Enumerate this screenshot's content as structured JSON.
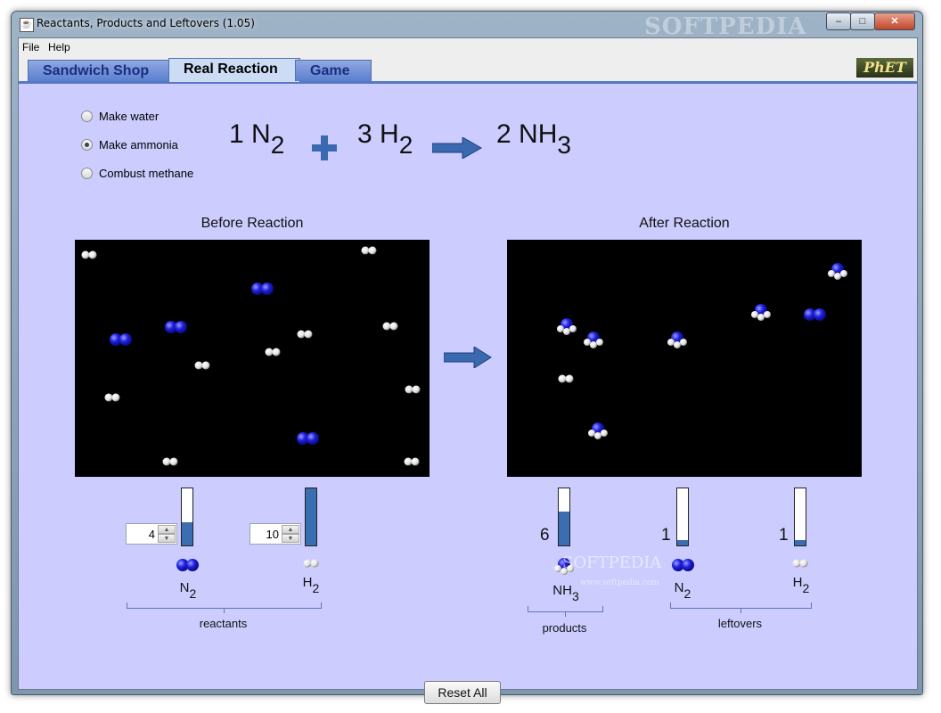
{
  "window": {
    "title": "Reactants, Products and Leftovers (1.05)",
    "watermark": "SOFTPEDIA",
    "controls": {
      "minimize": "–",
      "maximize": "□",
      "close": "✕"
    }
  },
  "menu": [
    "File",
    "Help"
  ],
  "tabs": [
    {
      "label": "Sandwich Shop",
      "active": false
    },
    {
      "label": "Real Reaction",
      "active": true
    },
    {
      "label": "Game",
      "active": false
    }
  ],
  "logo": "PhET",
  "reactions": [
    {
      "label": "Make water",
      "selected": false
    },
    {
      "label": "Make ammonia",
      "selected": true
    },
    {
      "label": "Combust methane",
      "selected": false
    }
  ],
  "equation": {
    "r1_coeff": "1",
    "r1_base": "N",
    "r1_sub": "2",
    "r2_coeff": "3",
    "r2_base": "H",
    "r2_sub": "2",
    "p_coeff": "2",
    "p_base": "NH",
    "p_sub": "3"
  },
  "before": {
    "title": "Before Reaction",
    "reactants": [
      {
        "formula_base": "N",
        "formula_sub": "2",
        "quantity": 4,
        "fraction": 0.4
      },
      {
        "formula_base": "H",
        "formula_sub": "2",
        "quantity": 10,
        "fraction": 1.0
      }
    ],
    "group_label": "reactants"
  },
  "after": {
    "title": "After Reaction",
    "products": [
      {
        "formula_base": "NH",
        "formula_sub": "3",
        "quantity": "6",
        "fraction": 0.6
      }
    ],
    "leftovers": [
      {
        "formula_base": "N",
        "formula_sub": "2",
        "quantity": "1",
        "fraction": 0.1
      },
      {
        "formula_base": "H",
        "formula_sub": "2",
        "quantity": "1",
        "fraction": 0.1
      }
    ],
    "products_label": "products",
    "leftovers_label": "leftovers"
  },
  "reset_label": "Reset All",
  "watermark_small": "www.softpedia.com",
  "colors": {
    "nitrogen": "#2020e0",
    "hydrogen": "#ffffff",
    "bar": "#3b6db1",
    "background": "#ccccff",
    "tab_active": "#ccdcf5"
  }
}
